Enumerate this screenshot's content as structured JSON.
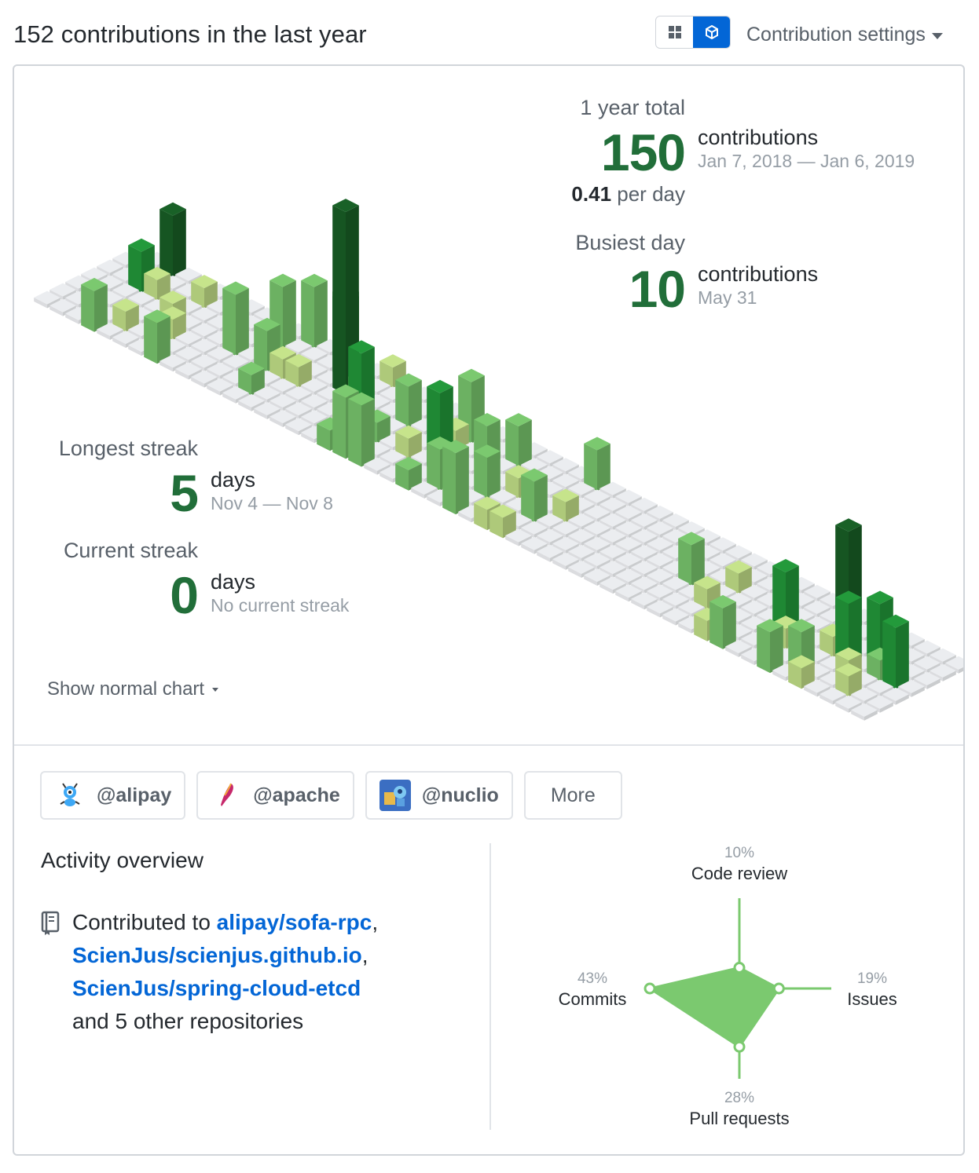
{
  "header": {
    "title": "152 contributions in the last year",
    "settings_label": "Contribution settings"
  },
  "colors": {
    "level1": "#c6e48b",
    "level2": "#7bc96f",
    "level3": "#239a3b",
    "level4": "#196127",
    "empty": "#ebedf0",
    "link": "#0366d6",
    "accent_green": "#216e39"
  },
  "stats": {
    "year_total_label": "1 year total",
    "year_total_value": "150",
    "year_total_unit": "contributions",
    "year_total_range": "Jan 7, 2018 — Jan 6, 2019",
    "per_day_value": "0.41",
    "per_day_unit": "per day",
    "busiest_label": "Busiest day",
    "busiest_value": "10",
    "busiest_unit": "contributions",
    "busiest_date": "May 31",
    "longest_label": "Longest streak",
    "longest_value": "5",
    "longest_unit": "days",
    "longest_range": "Nov 4 — Nov 8",
    "current_label": "Current streak",
    "current_value": "0",
    "current_unit": "days",
    "current_range": "No current streak"
  },
  "show_normal_label": "Show normal chart",
  "orgs": [
    {
      "label": "@alipay",
      "icon": "ant-icon"
    },
    {
      "label": "@apache",
      "icon": "feather-icon"
    },
    {
      "label": "@nuclio",
      "icon": "robot-icon"
    }
  ],
  "more_label": "More",
  "activity": {
    "title": "Activity overview",
    "contributed_to": "Contributed to",
    "repos": [
      "alipay/sofa-rpc",
      "ScienJus/scienjus.github.io",
      "ScienJus/spring-cloud-etcd"
    ],
    "comma": ",",
    "others": "and 5 other repositories"
  },
  "chart_data": {
    "type": "radar",
    "axes": [
      {
        "name": "Code review",
        "value": 10,
        "label": "10%"
      },
      {
        "name": "Issues",
        "value": 19,
        "label": "19%"
      },
      {
        "name": "Pull requests",
        "value": 28,
        "label": "28%"
      },
      {
        "name": "Commits",
        "value": 43,
        "label": "43%"
      }
    ]
  },
  "iso_bars": [
    {
      "week": 2,
      "day": 6,
      "level": 4,
      "h": 3
    },
    {
      "week": 2,
      "day": 4,
      "level": 3,
      "h": 2
    },
    {
      "week": 3,
      "day": 0,
      "level": 2,
      "h": 2
    },
    {
      "week": 3,
      "day": 4,
      "level": 1,
      "h": 1
    },
    {
      "week": 4,
      "day": 1,
      "level": 1,
      "h": 1
    },
    {
      "week": 5,
      "day": 5,
      "level": 1,
      "h": 1
    },
    {
      "week": 5,
      "day": 3,
      "level": 1,
      "h": 1
    },
    {
      "week": 6,
      "day": 1,
      "level": 1,
      "h": 1
    },
    {
      "week": 6,
      "day": 2,
      "level": 1,
      "h": 1
    },
    {
      "week": 7,
      "day": 0,
      "level": 2,
      "h": 2
    },
    {
      "week": 9,
      "day": 3,
      "level": 2,
      "h": 3
    },
    {
      "week": 10,
      "day": 5,
      "level": 2,
      "h": 3
    },
    {
      "week": 11,
      "day": 3,
      "level": 2,
      "h": 2
    },
    {
      "week": 11,
      "day": 6,
      "level": 2,
      "h": 3
    },
    {
      "week": 12,
      "day": 1,
      "level": 2,
      "h": 1
    },
    {
      "week": 12,
      "day": 3,
      "level": 1,
      "h": 1
    },
    {
      "week": 13,
      "day": 3,
      "level": 1,
      "h": 1
    },
    {
      "week": 13,
      "day": 6,
      "level": 3,
      "h": 3
    },
    {
      "week": 14,
      "day": 5,
      "level": 3,
      "h": 4
    },
    {
      "week": 15,
      "day": 4,
      "level": 4,
      "h": 9
    },
    {
      "week": 16,
      "day": 4,
      "level": 1,
      "h": 1
    },
    {
      "week": 16,
      "day": 6,
      "level": 1,
      "h": 1
    },
    {
      "week": 17,
      "day": 2,
      "level": 1,
      "h": 1
    },
    {
      "week": 18,
      "day": 0,
      "level": 2,
      "h": 1
    },
    {
      "week": 18,
      "day": 1,
      "level": 1,
      "h": 1
    },
    {
      "week": 18,
      "day": 2,
      "level": 3,
      "h": 4
    },
    {
      "week": 19,
      "day": 0,
      "level": 2,
      "h": 3
    },
    {
      "week": 19,
      "day": 2,
      "level": 2,
      "h": 1
    },
    {
      "week": 19,
      "day": 4,
      "level": 2,
      "h": 2
    },
    {
      "week": 20,
      "day": 0,
      "level": 2,
      "h": 3
    },
    {
      "week": 20,
      "day": 5,
      "level": 1,
      "h": 1
    },
    {
      "week": 21,
      "day": 2,
      "level": 1,
      "h": 1
    },
    {
      "week": 22,
      "day": 5,
      "level": 2,
      "h": 3
    },
    {
      "week": 22,
      "day": 4,
      "level": 1,
      "h": 1
    },
    {
      "week": 23,
      "day": 2,
      "level": 3,
      "h": 4
    },
    {
      "week": 23,
      "day": 0,
      "level": 2,
      "h": 1
    },
    {
      "week": 24,
      "day": 1,
      "level": 2,
      "h": 2
    },
    {
      "week": 24,
      "day": 4,
      "level": 2,
      "h": 2
    },
    {
      "week": 25,
      "day": 5,
      "level": 2,
      "h": 2
    },
    {
      "week": 26,
      "day": 2,
      "level": 2,
      "h": 2
    },
    {
      "week": 26,
      "day": 0,
      "level": 2,
      "h": 3
    },
    {
      "week": 27,
      "day": 3,
      "level": 1,
      "h": 1
    },
    {
      "week": 28,
      "day": 0,
      "level": 1,
      "h": 1
    },
    {
      "week": 29,
      "day": 2,
      "level": 2,
      "h": 2
    },
    {
      "week": 29,
      "day": 0,
      "level": 1,
      "h": 1
    },
    {
      "week": 30,
      "day": 3,
      "level": 1,
      "h": 1
    },
    {
      "week": 29,
      "day": 6,
      "level": 2,
      "h": 2
    },
    {
      "week": 38,
      "day": 3,
      "level": 2,
      "h": 2
    },
    {
      "week": 40,
      "day": 2,
      "level": 1,
      "h": 1
    },
    {
      "week": 40,
      "day": 4,
      "level": 1,
      "h": 1
    },
    {
      "week": 42,
      "day": 0,
      "level": 1,
      "h": 1
    },
    {
      "week": 43,
      "day": 0,
      "level": 2,
      "h": 2
    },
    {
      "week": 44,
      "day": 3,
      "level": 3,
      "h": 3
    },
    {
      "week": 45,
      "day": 2,
      "level": 1,
      "h": 1
    },
    {
      "week": 46,
      "day": 0,
      "level": 2,
      "h": 2
    },
    {
      "week": 46,
      "day": 5,
      "level": 4,
      "h": 5
    },
    {
      "week": 47,
      "day": 1,
      "level": 2,
      "h": 2
    },
    {
      "week": 47,
      "day": 3,
      "level": 1,
      "h": 1
    },
    {
      "week": 48,
      "day": 0,
      "level": 1,
      "h": 1
    },
    {
      "week": 48,
      "day": 3,
      "level": 3,
      "h": 3
    },
    {
      "week": 49,
      "day": 2,
      "level": 1,
      "h": 1
    },
    {
      "week": 49,
      "day": 4,
      "level": 3,
      "h": 3
    },
    {
      "week": 50,
      "day": 1,
      "level": 1,
      "h": 1
    },
    {
      "week": 50,
      "day": 3,
      "level": 2,
      "h": 1
    },
    {
      "week": 51,
      "day": 3,
      "level": 3,
      "h": 3
    }
  ]
}
